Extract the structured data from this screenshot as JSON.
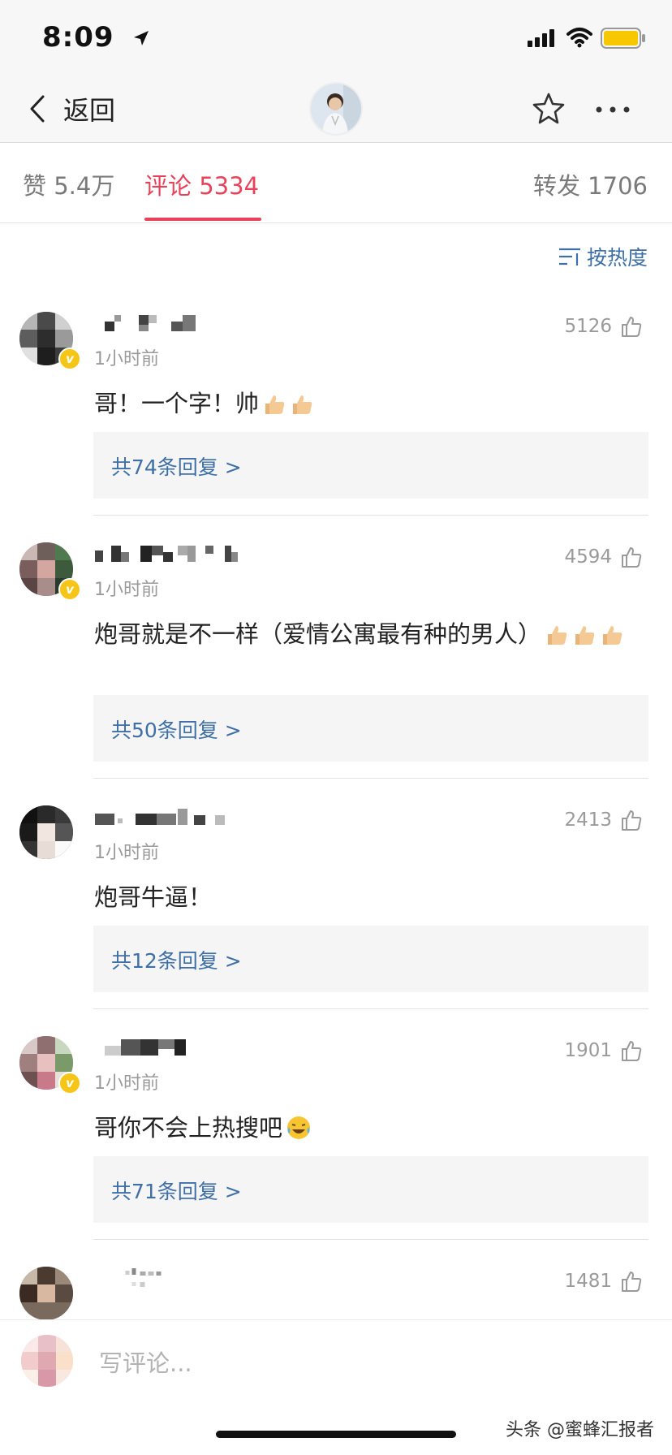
{
  "status": {
    "time": "8:09"
  },
  "nav": {
    "back_label": "返回"
  },
  "tabs": {
    "likes": "赞 5.4万",
    "comments": "评论 5334",
    "reposts": "转发 1706"
  },
  "sort": {
    "label": "按热度"
  },
  "comments": [
    {
      "time": "1小时前",
      "likes": "5126",
      "text": "哥！一个字！帅",
      "replies": "共74条回复 >"
    },
    {
      "time": "1小时前",
      "likes": "4594",
      "text": "炮哥就是不一样（爱情公寓最有种的男人）",
      "replies": "共50条回复 >"
    },
    {
      "time": "1小时前",
      "likes": "2413",
      "text": "炮哥牛逼！",
      "replies": "共12条回复 >"
    },
    {
      "time": "1小时前",
      "likes": "1901",
      "text": "哥你不会上热搜吧",
      "replies": "共71条回复 >"
    },
    {
      "likes": "1481"
    }
  ],
  "composer": {
    "placeholder": "写评论..."
  },
  "watermark": "头条 @蜜蜂汇报者",
  "colors": {
    "accent": "#e8425b",
    "link": "#3e6fa6",
    "verified": "#f5c518"
  }
}
